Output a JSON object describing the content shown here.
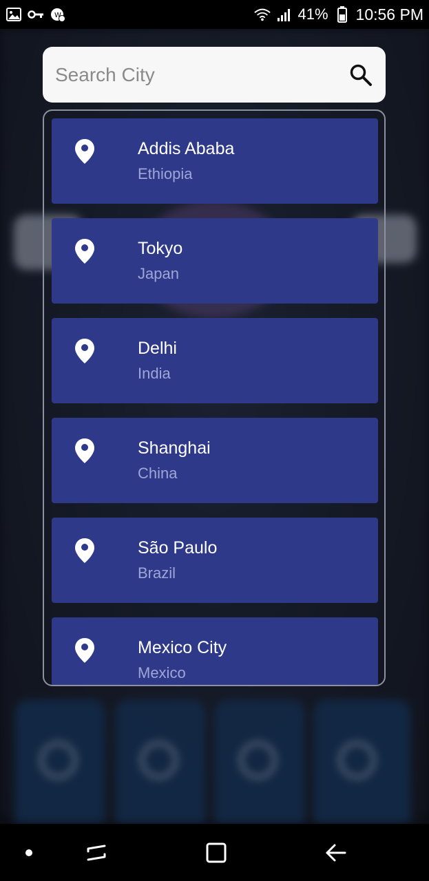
{
  "status_bar": {
    "battery_percent": "41%",
    "time": "10:56 PM",
    "icons": [
      "gallery-icon",
      "vpn-key-icon",
      "sync-badge-icon",
      "wifi-icon",
      "signal-icon",
      "battery-icon"
    ]
  },
  "search": {
    "placeholder": "Search City",
    "value": "",
    "icon": "search-icon"
  },
  "cities": [
    {
      "city": "Addis Ababa",
      "country": "Ethiopia"
    },
    {
      "city": "Tokyo",
      "country": "Japan"
    },
    {
      "city": "Delhi",
      "country": "India"
    },
    {
      "city": "Shanghai",
      "country": "China"
    },
    {
      "city": "São Paulo",
      "country": "Brazil"
    },
    {
      "city": "Mexico City",
      "country": "Mexico"
    }
  ],
  "list_item_icon": "location-pin-icon",
  "nav_bar": {
    "buttons": [
      "nav-dot-icon",
      "recents-icon",
      "home-icon",
      "back-icon"
    ]
  },
  "colors": {
    "list_item_bg": "#2e398a",
    "country_text": "#9fa6d6",
    "search_bg": "#f7f7f7"
  }
}
